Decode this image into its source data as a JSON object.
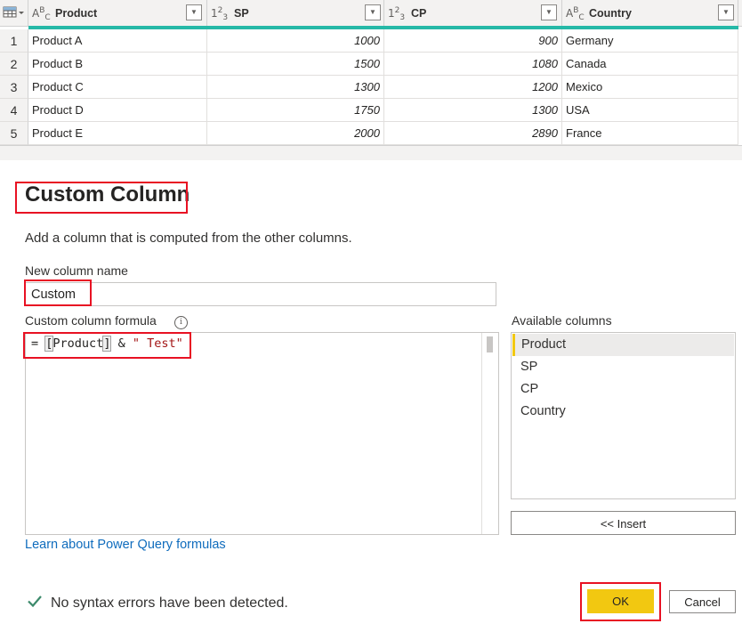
{
  "grid": {
    "columns": [
      {
        "name": "Product",
        "type_icon": "abc-text-type-icon",
        "type_main": "A",
        "type_sup": "B",
        "type_sub": "C"
      },
      {
        "name": "SP",
        "type_icon": "123-number-type-icon",
        "type_main": "1",
        "type_sup": "2",
        "type_sub": "3"
      },
      {
        "name": "CP",
        "type_icon": "123-number-type-icon",
        "type_main": "1",
        "type_sup": "2",
        "type_sub": "3"
      },
      {
        "name": "Country",
        "type_icon": "abc-text-type-icon",
        "type_main": "A",
        "type_sup": "B",
        "type_sub": "C"
      }
    ],
    "rows": [
      {
        "n": "1",
        "product": "Product A",
        "sp": "1000",
        "cp": "900",
        "country": "Germany"
      },
      {
        "n": "2",
        "product": "Product B",
        "sp": "1500",
        "cp": "1080",
        "country": "Canada"
      },
      {
        "n": "3",
        "product": "Product C",
        "sp": "1300",
        "cp": "1200",
        "country": "Mexico"
      },
      {
        "n": "4",
        "product": "Product D",
        "sp": "1750",
        "cp": "1300",
        "country": "USA"
      },
      {
        "n": "5",
        "product": "Product E",
        "sp": "2000",
        "cp": "2890",
        "country": "France"
      }
    ],
    "accent_color": "#26b9a7"
  },
  "dialog": {
    "title": "Custom Column",
    "description": "Add a column that is computed from the other columns.",
    "name_label": "New column name",
    "name_value": "Custom",
    "formula_label": "Custom column formula",
    "info_glyph": "i",
    "formula": {
      "prefix": "= ",
      "open_bracket": "[",
      "column": "Product",
      "close_bracket": "]",
      "operator": " & ",
      "string": "\" Test\""
    },
    "available_label": "Available columns",
    "available_columns": [
      "Product",
      "SP",
      "CP",
      "Country"
    ],
    "insert_label": "<< Insert",
    "learn_link": "Learn about Power Query formulas",
    "status_text": "No syntax errors have been detected.",
    "ok_label": "OK",
    "cancel_label": "Cancel",
    "ok_color": "#f2c811",
    "highlight_color": "#e81123"
  }
}
